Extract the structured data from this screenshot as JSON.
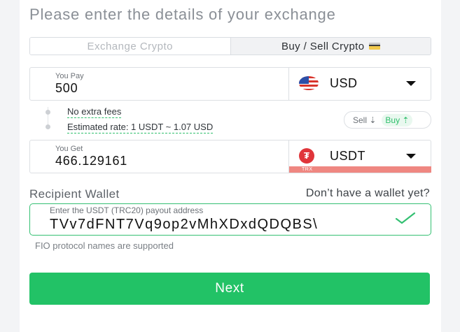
{
  "title": "Please enter the details of your exchange",
  "tabs": {
    "exchange": "Exchange Crypto",
    "buy_sell": "Buy / Sell Crypto"
  },
  "you_pay": {
    "label": "You Pay",
    "value": "500",
    "currency": "USD"
  },
  "info": {
    "fees": "No extra fees",
    "rate": "Estimated rate: 1 USDT ~ 1.07 USD"
  },
  "toggle": {
    "sell": "Sell ⇣",
    "buy": "Buy ⇡"
  },
  "you_get": {
    "label": "You Get",
    "value": "466.129161",
    "currency": "USDT",
    "network": "TRX"
  },
  "recipient": {
    "title": "Recipient Wallet",
    "no_wallet_link": "Don’t have a wallet yet?",
    "placeholder": "Enter the USDT (TRC20) payout address",
    "address": "TVv7dFNT7Vq9op2vMhXDxdQDQBS\\"
  },
  "fio_note": "FIO protocol names are supported",
  "next_button": "Next",
  "colors": {
    "accent": "#22c266",
    "trx_bar": "#ef8781",
    "tether": "#e0353a"
  },
  "icons": [
    "credit-card-icon",
    "us-flag-icon",
    "tether-icon",
    "chevron-down-icon",
    "check-icon"
  ]
}
